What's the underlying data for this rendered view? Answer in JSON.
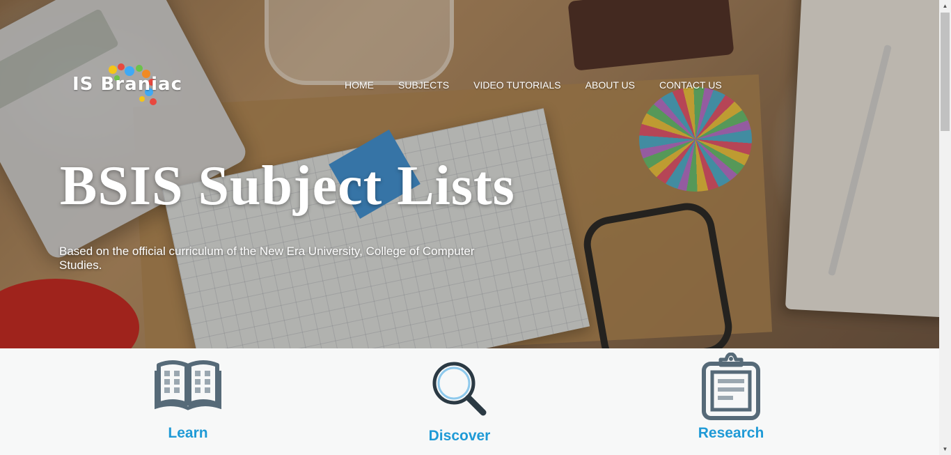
{
  "brand": {
    "logo_text": "IS Braniac"
  },
  "nav": {
    "items": [
      {
        "label": "HOME"
      },
      {
        "label": "SUBJECTS"
      },
      {
        "label": "VIDEO TUTORIALS"
      },
      {
        "label": "ABOUT US"
      },
      {
        "label": "CONTACT US"
      }
    ]
  },
  "hero": {
    "title": "BSIS Subject Lists",
    "subtitle": "Based on the official curriculum of the New Era University, College of Computer Studies."
  },
  "features": [
    {
      "label": "Learn",
      "icon": "book-icon"
    },
    {
      "label": "Discover",
      "icon": "magnifier-icon"
    },
    {
      "label": "Research",
      "icon": "clipboard-icon"
    }
  ],
  "colors": {
    "accent": "#1f9ad6",
    "icon": "#566a78",
    "background": "#f7f8f8"
  }
}
